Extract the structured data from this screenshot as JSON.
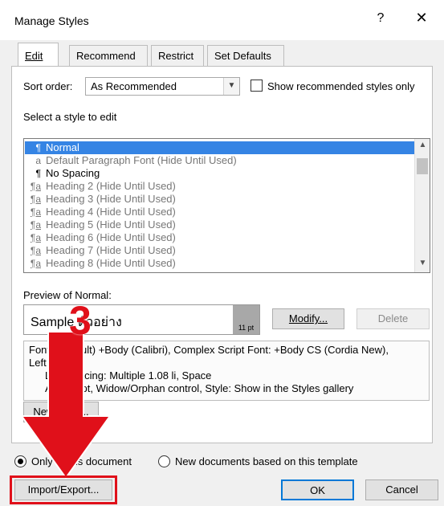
{
  "dialog": {
    "title": "Manage Styles",
    "help_label": "?",
    "close_label": "✕"
  },
  "tabs": [
    {
      "label": "Edit",
      "active": true
    },
    {
      "label": "Recommend",
      "active": false
    },
    {
      "label": "Restrict",
      "active": false
    },
    {
      "label": "Set Defaults",
      "active": false
    }
  ],
  "sort": {
    "label": "Sort order:",
    "value": "As Recommended",
    "show_recommended_label": "Show recommended styles only",
    "show_recommended_checked": false
  },
  "styles": {
    "heading": "Select a style to edit",
    "items": [
      {
        "symbol": "¶",
        "name": "Normal",
        "selected": true
      },
      {
        "symbol": "a",
        "name": "Default Paragraph Font  (Hide Until Used)",
        "selected": false
      },
      {
        "symbol": "¶",
        "name": "No Spacing",
        "selected": false
      },
      {
        "symbol": "¶a",
        "name": "Heading 2  (Hide Until Used)",
        "selected": false
      },
      {
        "symbol": "¶a",
        "name": "Heading 3  (Hide Until Used)",
        "selected": false
      },
      {
        "symbol": "¶a",
        "name": "Heading 4  (Hide Until Used)",
        "selected": false
      },
      {
        "symbol": "¶a",
        "name": "Heading 5  (Hide Until Used)",
        "selected": false
      },
      {
        "symbol": "¶a",
        "name": "Heading 6  (Hide Until Used)",
        "selected": false
      },
      {
        "symbol": "¶a",
        "name": "Heading 7  (Hide Until Used)",
        "selected": false
      },
      {
        "symbol": "¶a",
        "name": "Heading 8  (Hide Until Used)",
        "selected": false
      }
    ]
  },
  "preview": {
    "label": "Preview of Normal:",
    "sample_text": "Sample ตัวอย่าง",
    "size": "11 pt",
    "modify_label": "Modify...",
    "delete_label": "Delete"
  },
  "description": {
    "line1": "Font: (Default) +Body (Calibri), Complex Script Font: +Body CS (Cordia New),",
    "line1b": "Left",
    "line2": "Line spacing:  Multiple 1.08 li, Space",
    "line3": "After:  8 pt, Widow/Orphan control, Style: Show in the Styles gallery"
  },
  "new_style_label": "New Style...",
  "scope": {
    "option1": "Only in this document",
    "option2": "New documents based on this template",
    "selected": "option1"
  },
  "footer": {
    "import_export_label": "Import/Export...",
    "ok_label": "OK",
    "cancel_label": "Cancel"
  },
  "annotation": {
    "step_number": "3",
    "highlight_color": "#e0101a"
  },
  "colors": {
    "selection": "#3584e4",
    "annotation_red": "#e0101a"
  }
}
